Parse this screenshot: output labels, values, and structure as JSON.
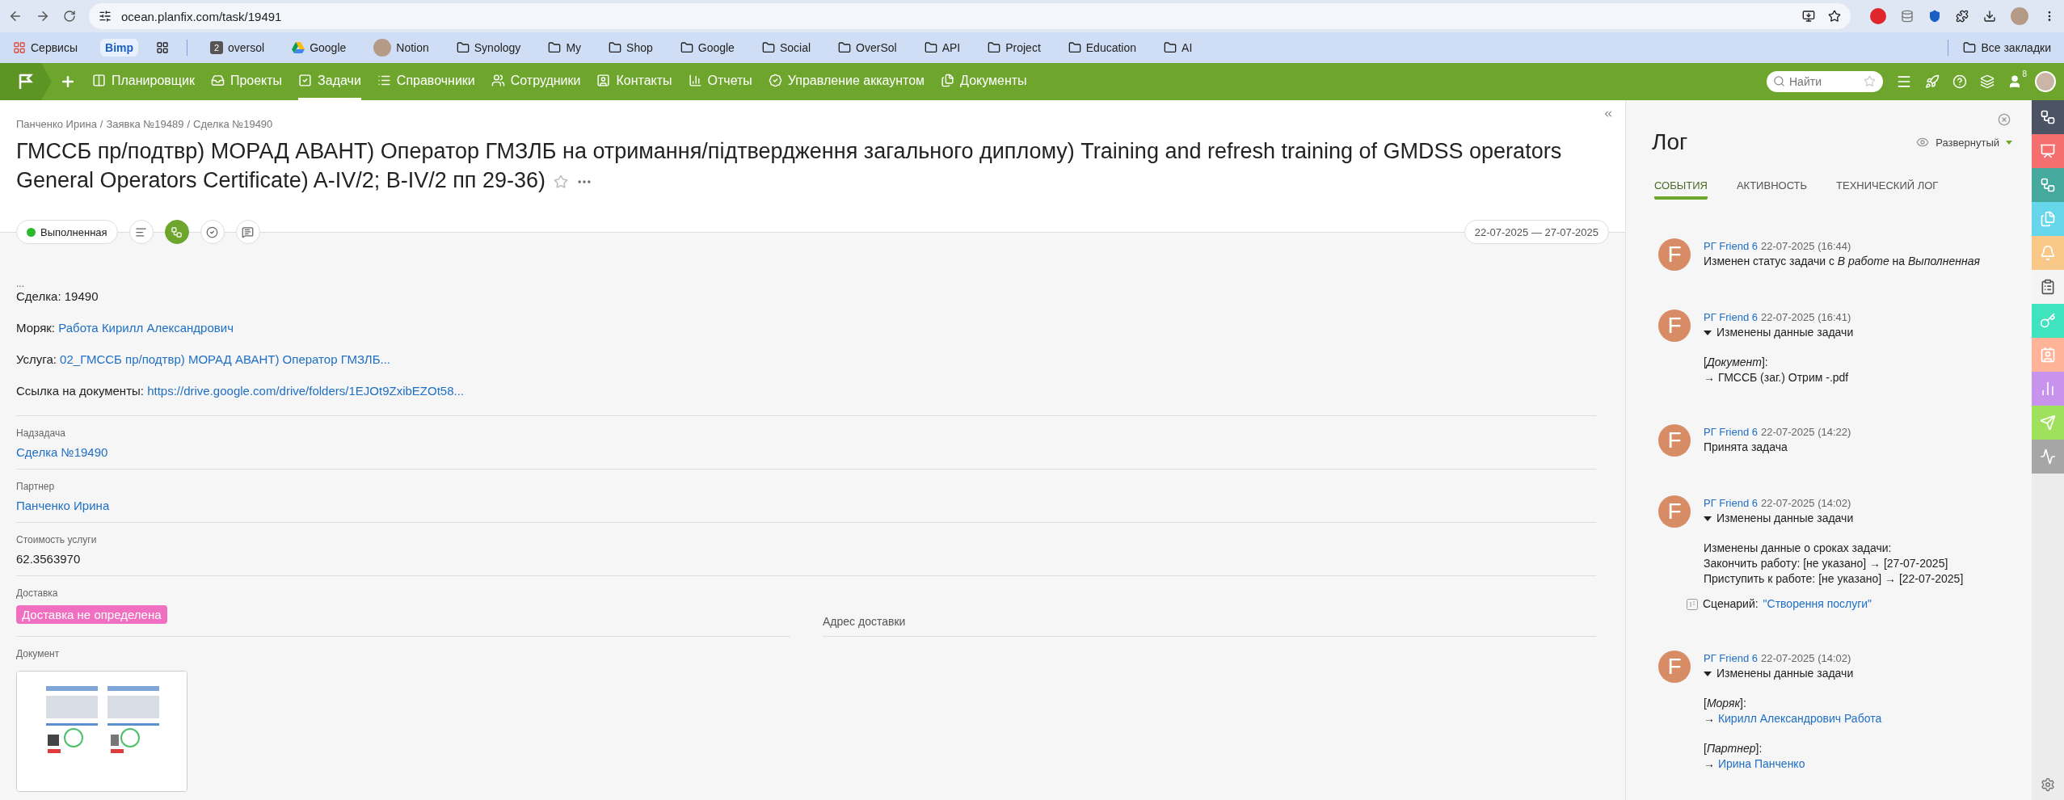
{
  "browser": {
    "url": "ocean.planfix.com/task/19491",
    "bookmarks": [
      {
        "label": "Сервисы",
        "kind": "apps",
        "selected": false
      },
      {
        "label": "Bimp",
        "kind": "site",
        "selected": true
      },
      {
        "label": "oversol",
        "kind": "badge",
        "selected": false
      },
      {
        "label": "Google",
        "kind": "drive",
        "selected": false
      },
      {
        "label": "Notion",
        "kind": "avatar",
        "selected": false
      },
      {
        "label": "Synology",
        "kind": "folder",
        "selected": false
      },
      {
        "label": "My",
        "kind": "folder",
        "selected": false
      },
      {
        "label": "Shop",
        "kind": "folder",
        "selected": false
      },
      {
        "label": "Google",
        "kind": "folder",
        "selected": false
      },
      {
        "label": "Social",
        "kind": "folder",
        "selected": false
      },
      {
        "label": "OverSol",
        "kind": "folder",
        "selected": false
      },
      {
        "label": "API",
        "kind": "folder",
        "selected": false
      },
      {
        "label": "Project",
        "kind": "folder",
        "selected": false
      },
      {
        "label": "Education",
        "kind": "folder",
        "selected": false
      },
      {
        "label": "AI",
        "kind": "folder",
        "selected": false
      }
    ],
    "badge_number": "2",
    "all_bookmarks": "Все закладки"
  },
  "nav": {
    "items": [
      {
        "label": "Планировщик",
        "selected": false
      },
      {
        "label": "Проекты",
        "selected": false
      },
      {
        "label": "Задачи",
        "selected": true
      },
      {
        "label": "Справочники",
        "selected": false
      },
      {
        "label": "Сотрудники",
        "selected": false
      },
      {
        "label": "Контакты",
        "selected": false
      },
      {
        "label": "Отчеты",
        "selected": false
      },
      {
        "label": "Управление аккаунтом",
        "selected": false
      },
      {
        "label": "Документы",
        "selected": false
      }
    ],
    "search": {
      "placeholder": "Найти"
    },
    "notification_count": "8"
  },
  "task": {
    "breadcrumb": [
      "Панченко Ирина",
      "Заявка №19489",
      "Сделка №19490"
    ],
    "breadcrumb_separator": "/",
    "title": "ГМССБ пр/подтвр) МОРАД АВАНТ) Оператор ГМЗЛБ на отримання/підтвердження загального диплому) Training and refresh training of GMDSS operators General Operators Certificate) A-IV/2; B-IV/2 пп 29-36)",
    "status": {
      "label": "Выполненная",
      "color": "#2eb82e"
    },
    "toolbar_buttons": [
      {
        "selected": false
      },
      {
        "selected": true
      },
      {
        "selected": false
      },
      {
        "selected": false
      }
    ],
    "dates": "22-07-2025 — 27-07-2025",
    "description": {
      "intro": "...",
      "lines": [
        {
          "label": "Сделка:",
          "value": "19490",
          "kind": "text"
        },
        {
          "label": "Моряк:",
          "value": "Работа Кирилл Александрович",
          "kind": "link"
        },
        {
          "label": "Услуга:",
          "value": "02_ГМССБ пр/подтвр) МОРАД АВАНТ) Оператор ГМЗЛБ...",
          "kind": "link"
        },
        {
          "label": "Ссылка на документы:",
          "value": "https://drive.google.com/drive/folders/1EJOt9ZxibEZOt58...",
          "kind": "link"
        }
      ]
    },
    "fields": [
      {
        "label": "Надзадача",
        "value": "Сделка №19490",
        "kind": "link"
      },
      {
        "label": "Партнер",
        "value": "Панченко Ирина",
        "kind": "link"
      },
      {
        "label": "Стоимость услуги",
        "value": "62.3563970",
        "kind": "text"
      }
    ],
    "delivery": {
      "label": "Доставка",
      "tag": {
        "label": "Доставка не определена",
        "color": "#f06fc0"
      },
      "address_label": "Адрес доставки"
    },
    "document": {
      "label": "Документ",
      "kind": "picture"
    }
  },
  "log": {
    "title": "Лог",
    "view": "Развернутый",
    "tabs": [
      {
        "label": "СОБЫТИЯ",
        "selected": true
      },
      {
        "label": "АКТИВНОСТЬ",
        "selected": false
      },
      {
        "label": "ТЕХНИЧЕСКИЙ ЛОГ",
        "selected": false
      }
    ],
    "entries": [
      {
        "avatar": "F",
        "author": "РГ Friend 6",
        "time": "22-07-2025 (16:44)",
        "kind": "plain",
        "text": "Изменен статус задачи  с *В работе* на *Выполненная*"
      },
      {
        "avatar": "F",
        "author": "РГ Friend 6",
        "time": "22-07-2025 (16:41)",
        "kind": "change",
        "expanded": true,
        "text": "Изменены данные задачи",
        "details": [
          {
            "lines": [
              {
                "text": "[*Документ*]:"
              },
              {
                "text": "→ ГМССБ (заг.) Отрим -.pdf"
              }
            ]
          }
        ]
      },
      {
        "avatar": "F",
        "author": "РГ Friend 6",
        "time": "22-07-2025 (14:22)",
        "kind": "plain",
        "text": "Принята задача"
      },
      {
        "avatar": "F",
        "author": "РГ Friend 6",
        "time": "22-07-2025 (14:02)",
        "kind": "change",
        "expanded": true,
        "text": "Изменены данные задачи",
        "details": [
          {
            "lines": [
              {
                "text": "Изменены данные о сроках задачи:"
              },
              {
                "text": "Закончить работу: [не указано] → [27-07-2025]"
              },
              {
                "text": "Приступить к работе: [не указано] → [22-07-2025]"
              }
            ]
          }
        ],
        "scenario": {
          "label": "Сценарий:",
          "link": "\"Створення послуги\""
        }
      },
      {
        "avatar": "F",
        "author": "РГ Friend 6",
        "time": "22-07-2025 (14:02)",
        "kind": "change",
        "expanded": true,
        "text": "Изменены данные задачи",
        "details": [
          {
            "lines": [
              {
                "text": "[*Моряк*]:"
              },
              {
                "text": "→",
                "link": "Кирилл Александрович Работа"
              }
            ]
          },
          {
            "lines": [
              {
                "text": "[*Партнер*]:"
              },
              {
                "text": "→",
                "link": "Ирина Панченко"
              }
            ]
          }
        ]
      }
    ]
  },
  "rail": [
    {
      "color": "#4b5365",
      "selected": false
    },
    {
      "color": "#f46f6f",
      "selected": false
    },
    {
      "color": "#45a99d",
      "selected": false
    },
    {
      "color": "#66d6ea",
      "selected": false
    },
    {
      "color": "#f8c888",
      "selected": false
    },
    {
      "color": "#f4f4f4",
      "selected": true
    },
    {
      "color": "#3fe3bd",
      "selected": false
    },
    {
      "color": "#ffb49a",
      "selected": false
    },
    {
      "color": "#c793ec",
      "selected": false
    },
    {
      "color": "#9fe05c",
      "selected": false
    },
    {
      "color": "#a6a6a6",
      "selected": false
    }
  ]
}
